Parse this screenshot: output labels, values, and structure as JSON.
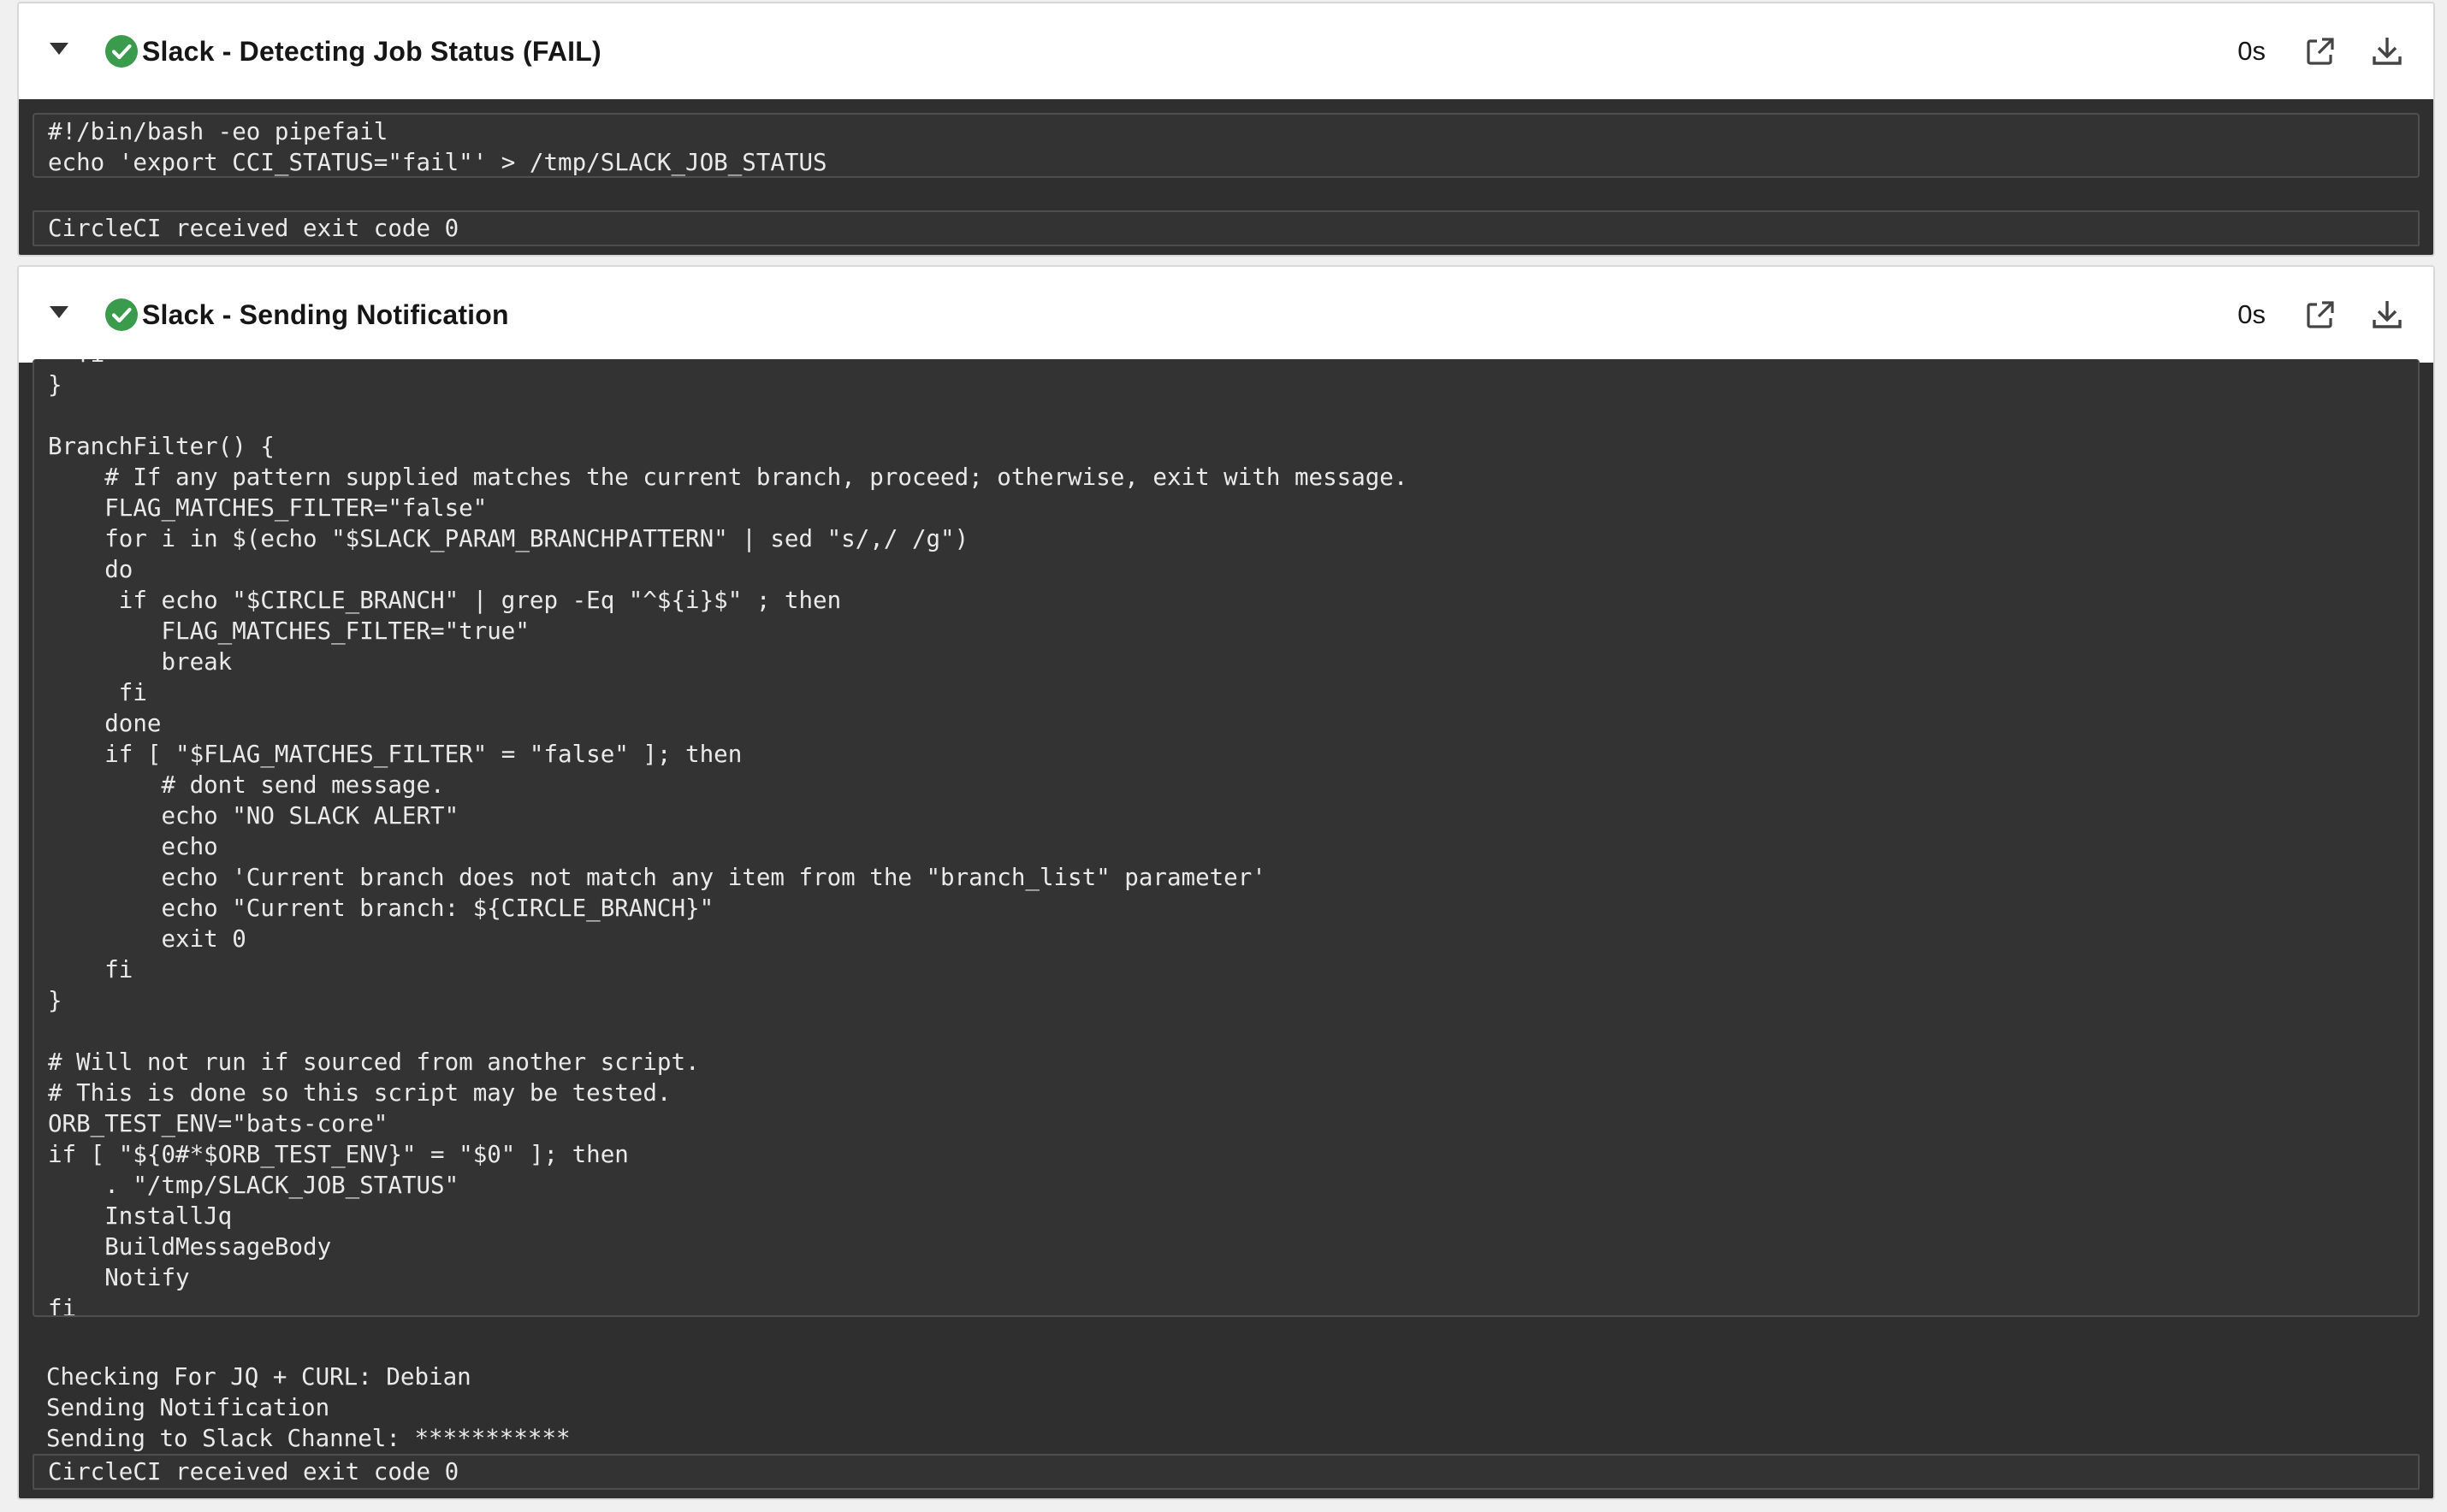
{
  "colors": {
    "success": "#3a9b4d",
    "header_bg": "#ffffff",
    "body_bg": "#2f2f2f",
    "code_bg": "#333333",
    "code_text": "#eaeaea"
  },
  "step1": {
    "title": "Slack - Detecting Job Status (FAIL)",
    "duration": "0s",
    "status_icon": "check-circle-icon",
    "script": "#!/bin/bash -eo pipefail\necho 'export CCI_STATUS=\"fail\"' > /tmp/SLACK_JOB_STATUS",
    "exit_message": "CircleCI received exit code 0"
  },
  "step2": {
    "title": "Slack - Sending Notification",
    "duration": "0s",
    "status_icon": "check-circle-icon",
    "script_partial_top": "  fi",
    "script": "}\n\nBranchFilter() {\n    # If any pattern supplied matches the current branch, proceed; otherwise, exit with message.\n    FLAG_MATCHES_FILTER=\"false\"\n    for i in $(echo \"$SLACK_PARAM_BRANCHPATTERN\" | sed \"s/,/ /g\")\n    do\n     if echo \"$CIRCLE_BRANCH\" | grep -Eq \"^${i}$\" ; then\n        FLAG_MATCHES_FILTER=\"true\"\n        break\n     fi\n    done\n    if [ \"$FLAG_MATCHES_FILTER\" = \"false\" ]; then\n        # dont send message.\n        echo \"NO SLACK ALERT\"\n        echo\n        echo 'Current branch does not match any item from the \"branch_list\" parameter'\n        echo \"Current branch: ${CIRCLE_BRANCH}\"\n        exit 0\n    fi\n}\n\n# Will not run if sourced from another script.\n# This is done so this script may be tested.\nORB_TEST_ENV=\"bats-core\"\nif [ \"${0#*$ORB_TEST_ENV}\" = \"$0\" ]; then\n    . \"/tmp/SLACK_JOB_STATUS\"\n    InstallJq\n    BuildMessageBody\n    Notify\nfi",
    "output": "Checking For JQ + CURL: Debian\nSending Notification\nSending to Slack Channel: ***********",
    "exit_message": "CircleCI received exit code 0"
  }
}
